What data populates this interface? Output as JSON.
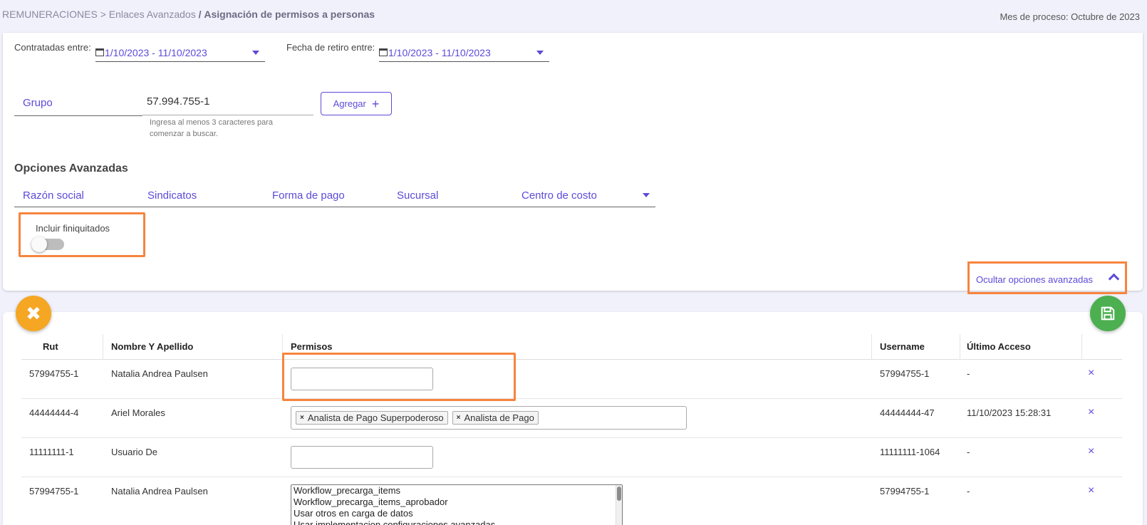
{
  "breadcrumb": {
    "root": "REMUNERACIONES",
    "sep1": ">",
    "middle": "Enlaces Avanzados",
    "sep2": "/",
    "current": "Asignación de permisos a personas"
  },
  "process_month": "Mes de proceso: Octubre de 2023",
  "filters": {
    "hired_label": "Contratadas entre:",
    "hired_value": "1/10/2023 - 11/10/2023",
    "retire_label": "Fecha de retiro entre:",
    "retire_value": "1/10/2023 - 11/10/2023",
    "group_label": "Grupo",
    "group_value": "57.994.755-1",
    "group_hint": "Ingresa al menos 3 caracteres para comenzar a buscar.",
    "add_label": "Agregar",
    "add_icon": "+"
  },
  "advanced": {
    "title": "Opciones Avanzadas",
    "options": [
      "Razón social",
      "Sindicatos",
      "Forma de pago",
      "Sucursal",
      "Centro de costo"
    ],
    "include_label": "Incluir finiquitados",
    "include_on": false,
    "hide_label": "Ocultar opciones avanzadas"
  },
  "fabs": {
    "close_icon": "✖",
    "save_icon": "save-icon"
  },
  "table": {
    "headers": [
      "Rut",
      "Nombre Y Apellido",
      "Permisos",
      "Username",
      "Último Acceso"
    ],
    "rows": [
      {
        "rut": "57994755-1",
        "name": "Natalia Andrea Paulsen",
        "username": "57994755-1",
        "last": "-",
        "remove": "×"
      },
      {
        "rut": "44444444-4",
        "name": "Ariel Morales",
        "chips": [
          "Analista de Pago Superpoderoso",
          "Analista de Pago"
        ],
        "chip_remove": "×",
        "username": "44444444-47",
        "last": "11/10/2023 15:28:31",
        "remove": "×"
      },
      {
        "rut": "11111111-1",
        "name": "Usuario De",
        "username": "11111111-1064",
        "last": "-",
        "remove": "×"
      },
      {
        "rut": "57994755-1",
        "name": "Natalia Andrea Paulsen",
        "options": [
          "Workflow_precarga_items",
          "Workflow_precarga_items_aprobador",
          "Usar otros en carga de datos",
          "Usar implementacion configuraciones avanzadas"
        ],
        "username": "57994755-1",
        "last": "-",
        "remove": "×"
      }
    ]
  },
  "colors": {
    "accent": "#5c4ad9",
    "highlight": "#f7843e",
    "fab_close": "#f5a623",
    "fab_save": "#4caf50"
  }
}
